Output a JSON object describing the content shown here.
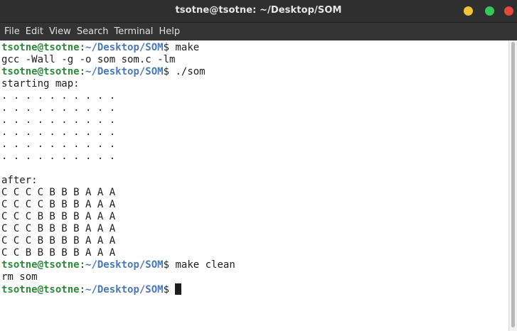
{
  "window": {
    "title": "tsotne@tsotne: ~/Desktop/SOM",
    "buttons": {
      "minimize_color": "#f4c437",
      "maximize_color": "#34c759",
      "close_color": "#e8473b"
    }
  },
  "menubar": {
    "items": [
      "File",
      "Edit",
      "View",
      "Search",
      "Terminal",
      "Help"
    ]
  },
  "terminal": {
    "colors": {
      "user": "#2d8a3a",
      "path": "#4a78b8",
      "text": "#1e1e1e",
      "background": "#ffffff"
    },
    "lines": [
      {
        "type": "prompt",
        "user": "tsotne@tsotne",
        "sep": ":",
        "path": "~/Desktop/SOM",
        "dollar": "$",
        "command": " make"
      },
      {
        "type": "output",
        "text": "gcc -Wall -g -o som som.c -lm"
      },
      {
        "type": "prompt",
        "user": "tsotne@tsotne",
        "sep": ":",
        "path": "~/Desktop/SOM",
        "dollar": "$",
        "command": " ./som"
      },
      {
        "type": "output",
        "text": "starting map:"
      },
      {
        "type": "output",
        "text": ". . . . . . . . . ."
      },
      {
        "type": "output",
        "text": ". . . . . . . . . ."
      },
      {
        "type": "output",
        "text": ". . . . . . . . . ."
      },
      {
        "type": "output",
        "text": ". . . . . . . . . ."
      },
      {
        "type": "output",
        "text": ". . . . . . . . . ."
      },
      {
        "type": "output",
        "text": ". . . . . . . . . ."
      },
      {
        "type": "output",
        "text": ""
      },
      {
        "type": "output",
        "text": "after:"
      },
      {
        "type": "output",
        "text": "C C C C B B B A A A"
      },
      {
        "type": "output",
        "text": "C C C C B B B A A A"
      },
      {
        "type": "output",
        "text": "C C C B B B B A A A"
      },
      {
        "type": "output",
        "text": "C C C B B B B A A A"
      },
      {
        "type": "output",
        "text": "C C C B B B B A A A"
      },
      {
        "type": "output",
        "text": "C C B B B B B A A A"
      },
      {
        "type": "prompt",
        "user": "tsotne@tsotne",
        "sep": ":",
        "path": "~/Desktop/SOM",
        "dollar": "$",
        "command": " make clean"
      },
      {
        "type": "output",
        "text": "rm som"
      },
      {
        "type": "prompt",
        "user": "tsotne@tsotne",
        "sep": ":",
        "path": "~/Desktop/SOM",
        "dollar": "$",
        "command": " ",
        "cursor": true
      }
    ]
  }
}
